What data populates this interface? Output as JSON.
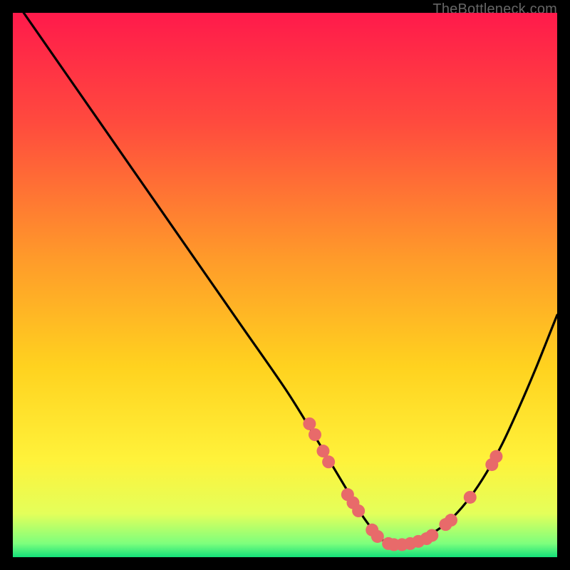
{
  "watermark": "TheBottleneck.com",
  "chart_data": {
    "type": "line",
    "title": "",
    "xlabel": "",
    "ylabel": "",
    "xlim": [
      0,
      100
    ],
    "ylim": [
      0,
      100
    ],
    "gradient_stops": [
      {
        "offset": 0.0,
        "color": "#ff1a4b"
      },
      {
        "offset": 0.2,
        "color": "#ff4a3e"
      },
      {
        "offset": 0.45,
        "color": "#ff9a2a"
      },
      {
        "offset": 0.65,
        "color": "#ffd21f"
      },
      {
        "offset": 0.82,
        "color": "#fff23a"
      },
      {
        "offset": 0.92,
        "color": "#e4ff5a"
      },
      {
        "offset": 0.975,
        "color": "#7dff7d"
      },
      {
        "offset": 1.0,
        "color": "#14e07a"
      }
    ],
    "series": [
      {
        "name": "left-branch",
        "x": [
          2,
          10,
          18,
          26,
          34,
          42,
          50,
          55,
          58,
          61,
          63,
          65,
          67,
          69
        ],
        "y": [
          100,
          88.5,
          77,
          65.5,
          54,
          42.5,
          31,
          23,
          18,
          13,
          9.5,
          6.5,
          4,
          2.3
        ]
      },
      {
        "name": "right-branch",
        "x": [
          69,
          72,
          75,
          78,
          81,
          84,
          87,
          90,
          93,
          96,
          99,
          100
        ],
        "y": [
          2.3,
          2.6,
          3.5,
          5.0,
          7.5,
          11,
          15.5,
          21,
          27.5,
          34.5,
          42,
          44.5
        ]
      }
    ],
    "scatter": {
      "name": "markers",
      "color": "#e86a6a",
      "radius": 9,
      "points": [
        {
          "x": 54.5,
          "y": 24.5
        },
        {
          "x": 55.5,
          "y": 22.5
        },
        {
          "x": 57.0,
          "y": 19.5
        },
        {
          "x": 58.0,
          "y": 17.5
        },
        {
          "x": 61.5,
          "y": 11.5
        },
        {
          "x": 62.5,
          "y": 10.0
        },
        {
          "x": 63.5,
          "y": 8.5
        },
        {
          "x": 66.0,
          "y": 5.0
        },
        {
          "x": 67.0,
          "y": 3.8
        },
        {
          "x": 69.0,
          "y": 2.5
        },
        {
          "x": 70.0,
          "y": 2.3
        },
        {
          "x": 71.5,
          "y": 2.3
        },
        {
          "x": 73.0,
          "y": 2.5
        },
        {
          "x": 74.5,
          "y": 2.9
        },
        {
          "x": 76.0,
          "y": 3.4
        },
        {
          "x": 77.0,
          "y": 4.0
        },
        {
          "x": 79.5,
          "y": 6.0
        },
        {
          "x": 80.5,
          "y": 6.8
        },
        {
          "x": 84.0,
          "y": 11.0
        },
        {
          "x": 88.0,
          "y": 17.0
        },
        {
          "x": 88.8,
          "y": 18.5
        }
      ]
    }
  }
}
